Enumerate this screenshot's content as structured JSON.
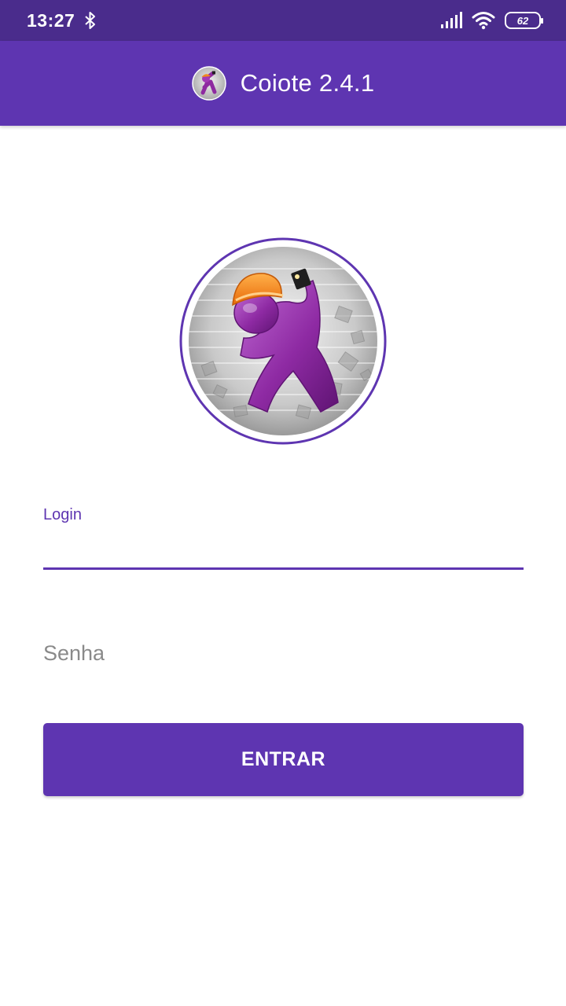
{
  "status_bar": {
    "time": "13:27",
    "battery": "62",
    "icons": [
      "bluetooth-icon",
      "signal-icon",
      "wifi-icon",
      "battery-icon"
    ]
  },
  "app_bar": {
    "title": "Coiote 2.4.1"
  },
  "form": {
    "login_label": "Login",
    "login_value": "",
    "password_placeholder": "Senha",
    "password_value": "",
    "submit_label": "ENTRAR"
  },
  "colors": {
    "status_bar": "#4a2c8c",
    "primary": "#5e35b1",
    "background": "#ffffff"
  }
}
